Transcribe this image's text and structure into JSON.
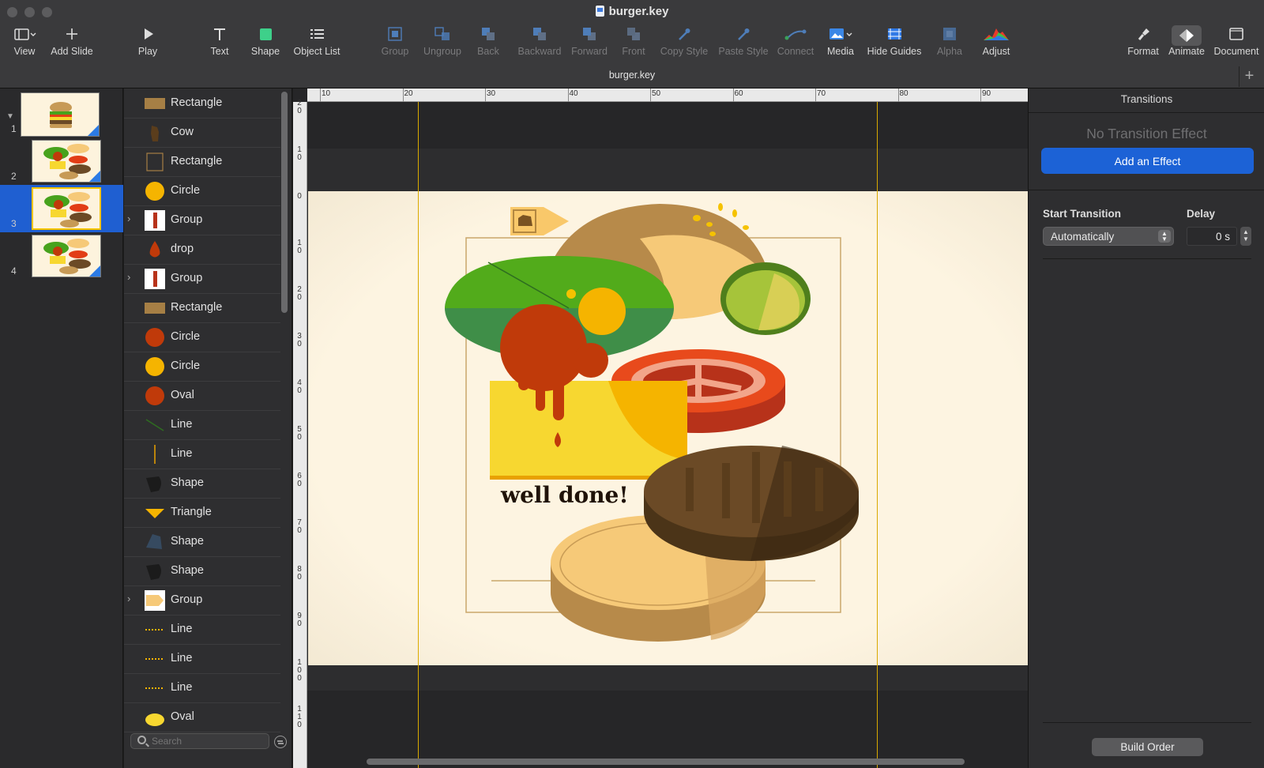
{
  "window": {
    "title": "burger.key",
    "tab_title": "burger.key"
  },
  "toolbar": {
    "view": "View",
    "add_slide": "Add Slide",
    "play": "Play",
    "text": "Text",
    "shape": "Shape",
    "object_list": "Object List",
    "group": "Group",
    "ungroup": "Ungroup",
    "back": "Back",
    "backward": "Backward",
    "forward": "Forward",
    "front": "Front",
    "copy_style": "Copy Style",
    "paste_style": "Paste Style",
    "connect": "Connect",
    "media": "Media",
    "hide_guides": "Hide Guides",
    "alpha": "Alpha",
    "adjust": "Adjust",
    "format": "Format",
    "animate": "Animate",
    "document": "Document"
  },
  "navigator": {
    "slides": [
      {
        "num": "1"
      },
      {
        "num": "2"
      },
      {
        "num": "3"
      },
      {
        "num": "4"
      }
    ],
    "selected": 3
  },
  "object_list": {
    "items": [
      {
        "label": "Rectangle"
      },
      {
        "label": "Cow"
      },
      {
        "label": "Rectangle"
      },
      {
        "label": "Circle"
      },
      {
        "label": "Group"
      },
      {
        "label": "drop"
      },
      {
        "label": "Group"
      },
      {
        "label": "Rectangle"
      },
      {
        "label": "Circle"
      },
      {
        "label": "Circle"
      },
      {
        "label": "Oval"
      },
      {
        "label": "Line"
      },
      {
        "label": "Line"
      },
      {
        "label": "Shape"
      },
      {
        "label": "Triangle"
      },
      {
        "label": "Shape"
      },
      {
        "label": "Shape"
      },
      {
        "label": "Group"
      },
      {
        "label": "Line"
      },
      {
        "label": "Line"
      },
      {
        "label": "Line"
      },
      {
        "label": "Oval"
      }
    ],
    "search_placeholder": "Search"
  },
  "ruler": {
    "top": [
      "10",
      "20",
      "30",
      "40",
      "50",
      "60",
      "70",
      "80",
      "90"
    ],
    "left": [
      "2\n0",
      "1\n0",
      "0",
      "1\n0",
      "2\n0",
      "3\n0",
      "4\n0",
      "5\n0",
      "6\n0",
      "7\n0",
      "8\n0",
      "9\n0",
      "1\n0\n0",
      "1\n1\n0"
    ]
  },
  "slide": {
    "caption": "well done!"
  },
  "inspector": {
    "title": "Transitions",
    "no_effect": "No Transition Effect",
    "add_effect": "Add an Effect",
    "start_label": "Start Transition",
    "start_value": "Automatically",
    "delay_label": "Delay",
    "delay_value": "0 s",
    "build_order": "Build Order"
  },
  "colors": {
    "accent": "#1c62d6",
    "selection": "#1f5fd1",
    "guide": "#d9a900",
    "bun": "#c79a56",
    "bun_light": "#f6c978",
    "lettuce": "#47a21c",
    "tomato": "#e23d16",
    "ketchup": "#c03a0a",
    "cheese": "#f7d730",
    "patty": "#6b4a26",
    "mustard": "#f5b400"
  }
}
